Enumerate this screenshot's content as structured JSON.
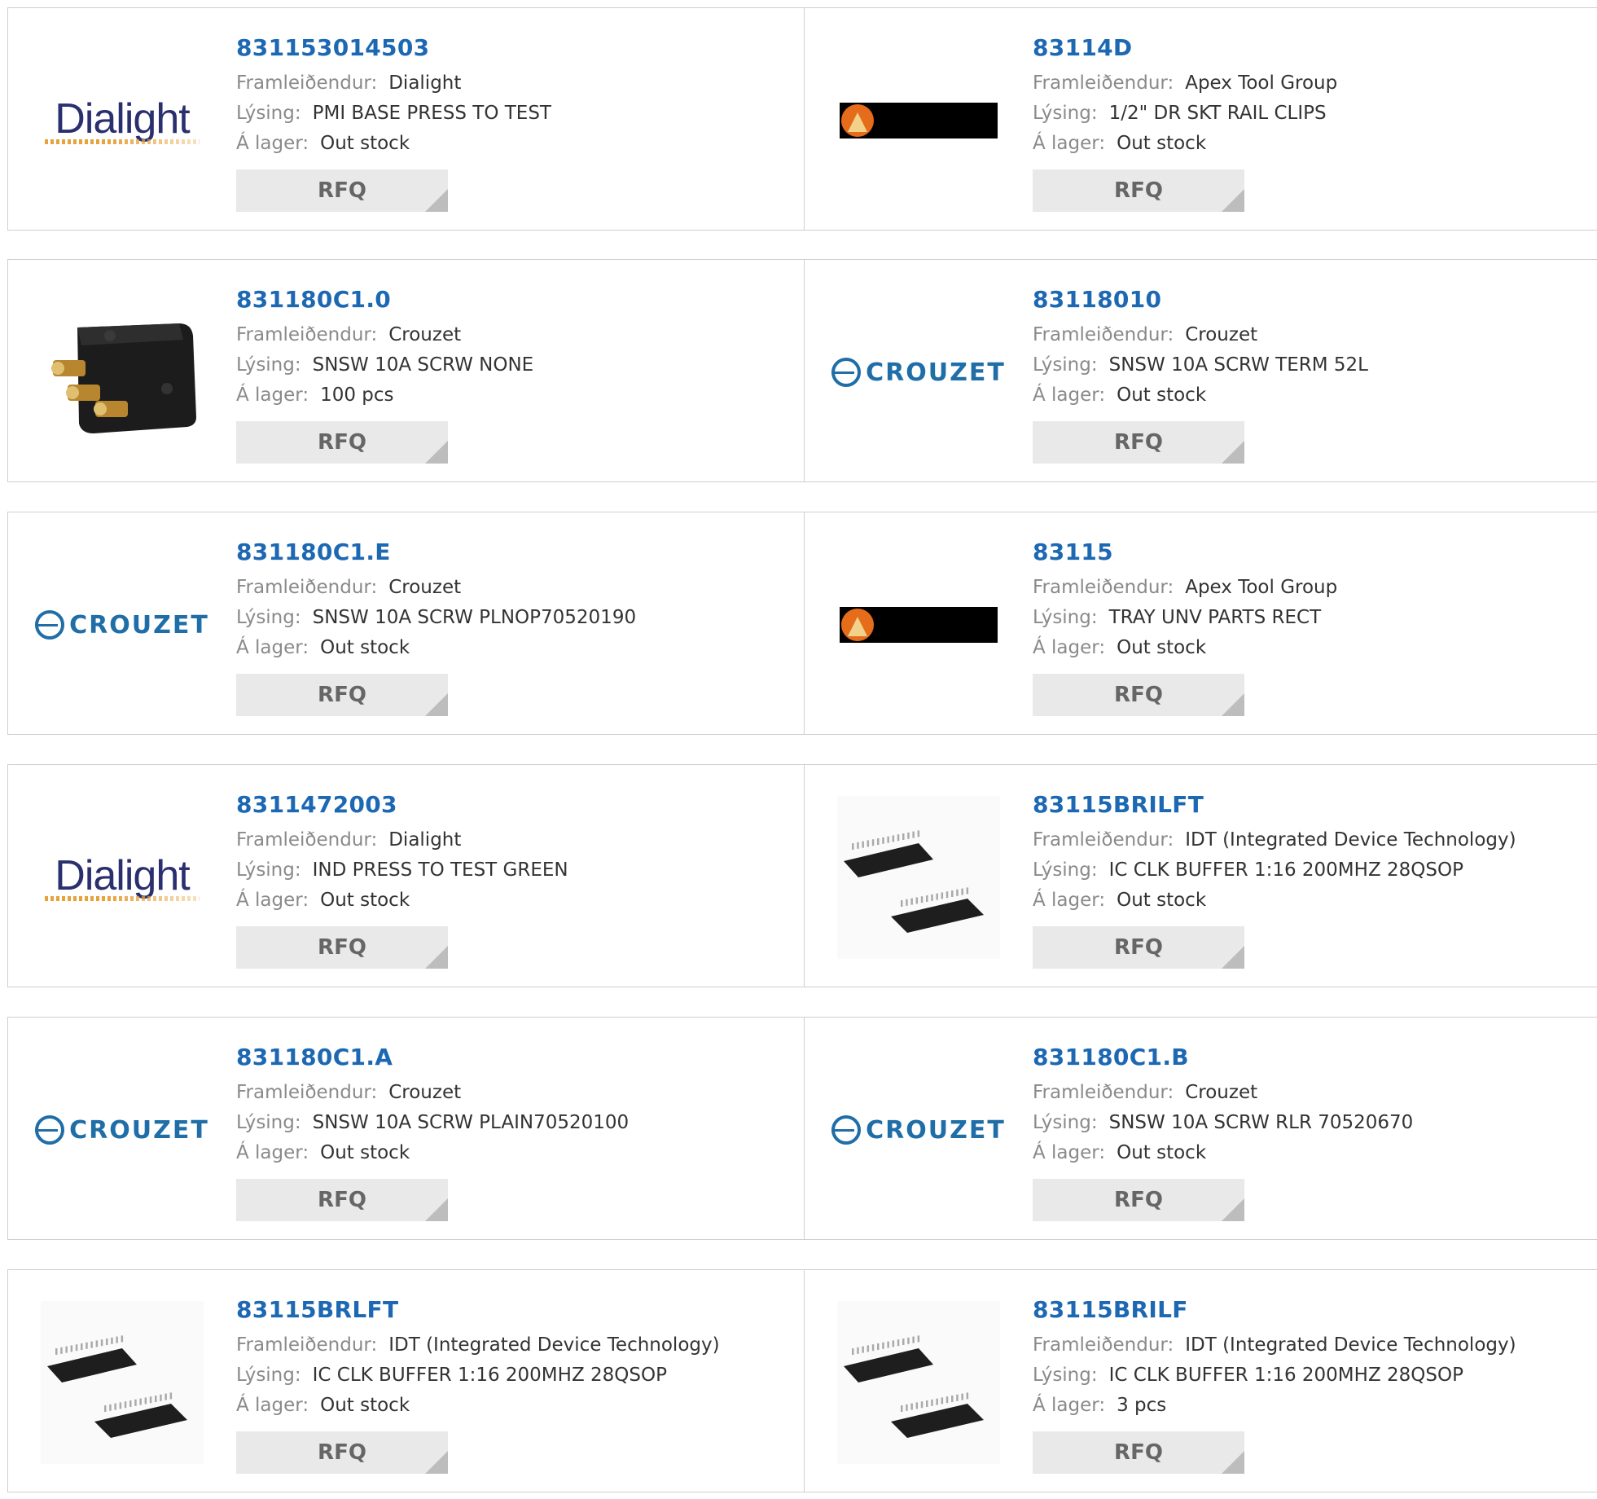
{
  "labels": {
    "manufacturer": "Framleiðendur:",
    "description": "Lýsing:",
    "stock": "Á lager:",
    "rfq": "RFQ"
  },
  "logos": {
    "dialight": "Dialight",
    "crouzet": "CROUZET"
  },
  "products": [
    {
      "part": "831153014503",
      "manufacturer": "Dialight",
      "description": "PMI BASE PRESS TO TEST",
      "stock": "Out stock",
      "image": "dialight-logo"
    },
    {
      "part": "83114D",
      "manufacturer": "Apex Tool Group",
      "description": "1/2\" DR SKT RAIL CLIPS",
      "stock": "Out stock",
      "image": "apex-logo"
    },
    {
      "part": "831180C1.0",
      "manufacturer": "Crouzet",
      "description": "SNSW 10A SCRW NONE",
      "stock": "100 pcs",
      "image": "switch-photo"
    },
    {
      "part": "83118010",
      "manufacturer": "Crouzet",
      "description": "SNSW 10A SCRW TERM 52L",
      "stock": "Out stock",
      "image": "crouzet-logo"
    },
    {
      "part": "831180C1.E",
      "manufacturer": "Crouzet",
      "description": "SNSW 10A SCRW PLNOP70520190",
      "stock": "Out stock",
      "image": "crouzet-logo"
    },
    {
      "part": "83115",
      "manufacturer": "Apex Tool Group",
      "description": "TRAY UNV PARTS RECT",
      "stock": "Out stock",
      "image": "apex-logo"
    },
    {
      "part": "8311472003",
      "manufacturer": "Dialight",
      "description": "IND PRESS TO TEST GREEN",
      "stock": "Out stock",
      "image": "dialight-logo"
    },
    {
      "part": "83115BRILFT",
      "manufacturer": "IDT (Integrated Device Technology)",
      "description": "IC CLK BUFFER 1:16 200MHZ 28QSOP",
      "stock": "Out stock",
      "image": "chip-photo"
    },
    {
      "part": "831180C1.A",
      "manufacturer": "Crouzet",
      "description": "SNSW 10A SCRW PLAIN70520100",
      "stock": "Out stock",
      "image": "crouzet-logo"
    },
    {
      "part": "831180C1.B",
      "manufacturer": "Crouzet",
      "description": "SNSW 10A SCRW RLR 70520670",
      "stock": "Out stock",
      "image": "crouzet-logo"
    },
    {
      "part": "83115BRLFT",
      "manufacturer": "IDT (Integrated Device Technology)",
      "description": "IC CLK BUFFER 1:16 200MHZ 28QSOP",
      "stock": "Out stock",
      "image": "chip-photo"
    },
    {
      "part": "83115BRILF",
      "manufacturer": "IDT (Integrated Device Technology)",
      "description": "IC CLK BUFFER 1:16 200MHZ 28QSOP",
      "stock": "3 pcs",
      "image": "chip-photo"
    }
  ]
}
